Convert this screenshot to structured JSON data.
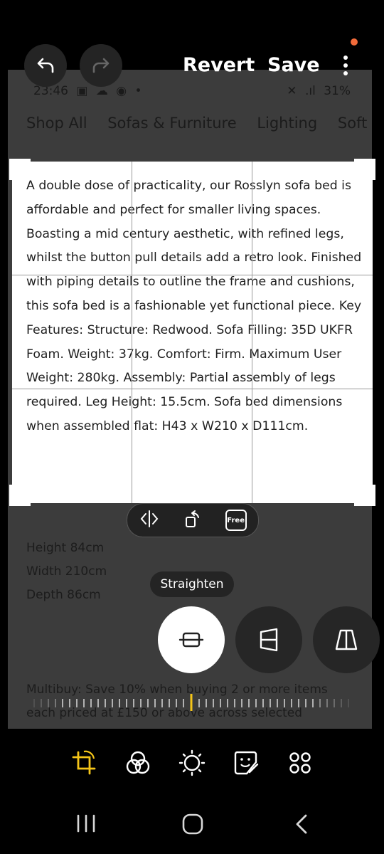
{
  "top_bar": {
    "revert_label": "Revert",
    "save_label": "Save"
  },
  "photo": {
    "status": {
      "time": "23:46",
      "battery": "31%"
    },
    "nav": [
      "Shop All",
      "Sofas & Furniture",
      "Lighting",
      "Soft F"
    ],
    "dimensions": [
      "Height 84cm",
      "Width 210cm",
      "Depth 86cm"
    ],
    "multibuy": [
      "Multibuy: Save 10% when buying 2 or more items",
      "each priced at £150 or above across selected"
    ]
  },
  "crop_text": "A double dose of practicality, our Rosslyn sofa bed is affordable and perfect for smaller living spaces. Boasting a mid century aesthetic, with refined legs, whilst the button pull details add a retro look. Finished with piping details to outline the frame and cushions, this sofa bed is a fashionable yet functional piece. Key Features: Structure: Redwood. Sofa Filling: 35D UKFR Foam. Weight: 37kg. Comfort: Firm. Maximum User Weight: 280kg. Assembly: Partial assembly of legs required. Leg Height: 15.5cm. Sofa bed dimensions when assembled flat: H43 x W210 x D111cm.",
  "tools": {
    "free_label": "Free"
  },
  "tooltip": "Straighten",
  "colors": {
    "accent": "#f5c518",
    "notification_dot": "#f26b3a"
  }
}
